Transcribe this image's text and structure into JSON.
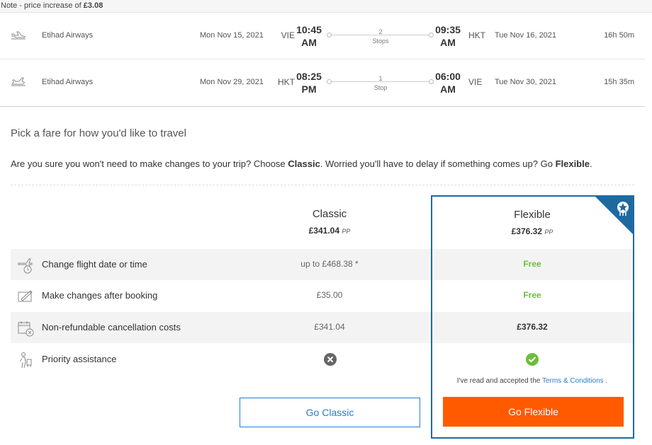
{
  "note": {
    "prefix": "Note - price increase of ",
    "amount": "£3.08"
  },
  "legs": [
    {
      "airline": "Etihad Airways",
      "depart_date": "Mon Nov 15, 2021",
      "depart_code": "VIE",
      "depart_time": "10:45",
      "depart_ampm": "AM",
      "stops_count": "2",
      "stops_label": "Stops",
      "arrive_time": "09:35",
      "arrive_ampm": "AM",
      "arrive_code": "HKT",
      "arrive_date": "Tue Nov 16, 2021",
      "duration": "16h 50m",
      "icon": "plane-departure-icon"
    },
    {
      "airline": "Etihad Airways",
      "depart_date": "Mon Nov 29, 2021",
      "depart_code": "HKT",
      "depart_time": "08:25",
      "depart_ampm": "PM",
      "stops_count": "1",
      "stops_label": "Stop",
      "arrive_time": "06:00",
      "arrive_ampm": "AM",
      "arrive_code": "VIE",
      "arrive_date": "Tue Nov 30, 2021",
      "duration": "15h 35m",
      "icon": "plane-return-icon"
    }
  ],
  "fare": {
    "heading": "Pick a fare for how you'd like to travel",
    "intro": {
      "part1": "Are you sure you won't need to make changes to your trip? Choose ",
      "classic": "Classic",
      "part2": ". Worried you'll have to delay if something comes up? Go ",
      "flexible": "Flexible",
      "part3": "."
    },
    "classic": {
      "name": "Classic",
      "price": "£341.04",
      "pp": "PP",
      "button": "Go Classic"
    },
    "flexible": {
      "name": "Flexible",
      "price": "£376.32",
      "pp": "PP",
      "button": "Go Flexible"
    },
    "rows": [
      {
        "label": "Change flight date or time",
        "classic": "up to £468.38 *",
        "flexible": "Free",
        "icon": "plane-clock-icon"
      },
      {
        "label": "Make changes after booking",
        "classic": "£35.00",
        "flexible": "Free",
        "icon": "edit-ticket-icon"
      },
      {
        "label": "Non-refundable cancellation costs",
        "classic": "£341.04",
        "flexible": "£376.32",
        "icon": "calendar-cancel-icon"
      },
      {
        "label": "Priority assistance",
        "icon": "assistance-icon",
        "classic_status": "not-included",
        "flexible_status": "included"
      }
    ],
    "terms": {
      "text": "I've read and accepted the ",
      "link": "Terms & Conditions",
      "end": " ."
    }
  },
  "colors": {
    "accent": "#1e6aa0",
    "link": "#2a7cc7",
    "cta": "#ff5a00",
    "green": "#6cbf3a"
  }
}
